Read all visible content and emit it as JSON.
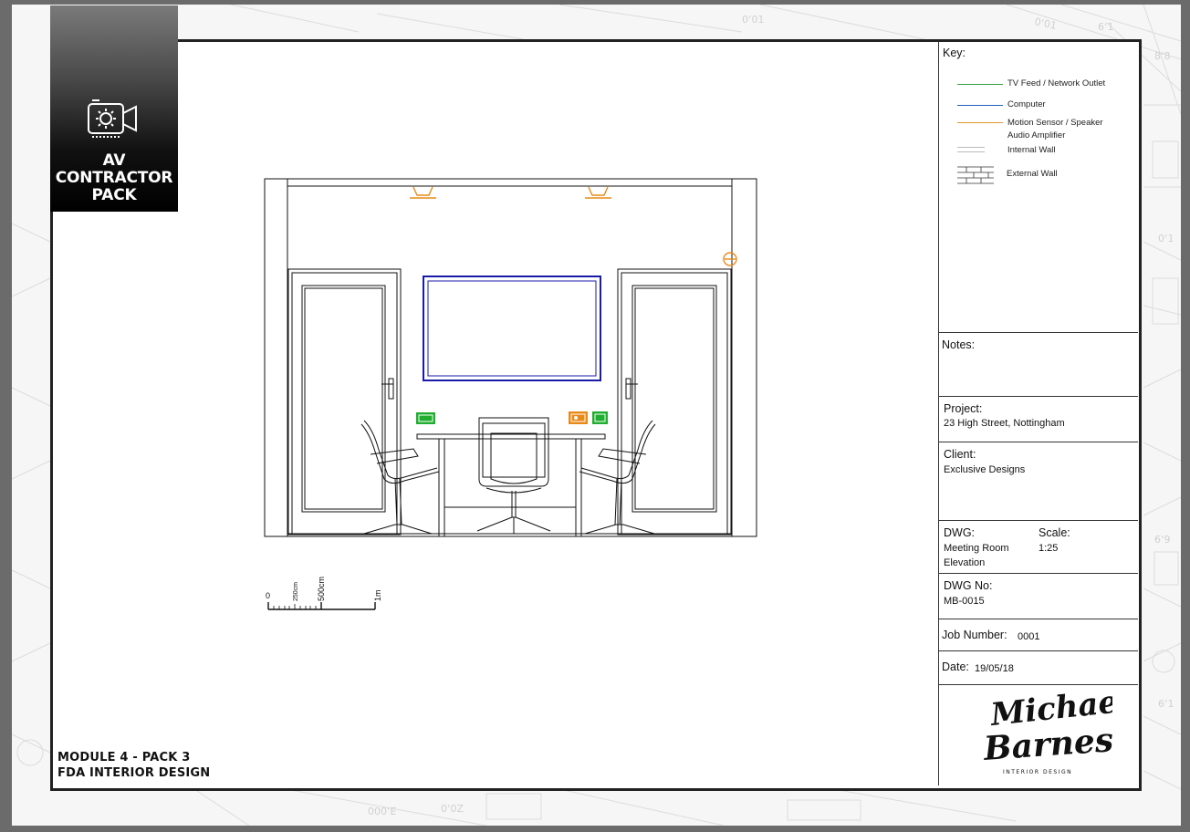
{
  "badge": {
    "line1": "AV",
    "line2": "CONTRACTOR",
    "line3": "PACK",
    "icon": "camera-gear-icon"
  },
  "module": {
    "line1": "MODULE 4 - PACK 3",
    "line2": "FDA INTERIOR DESIGN"
  },
  "title_block": {
    "key_label": "Key:",
    "key_items": [
      {
        "label": "TV Feed /  Network Outlet",
        "color": "#2e9e3e"
      },
      {
        "label": "Computer",
        "color": "#1f5fbf"
      },
      {
        "label": "Motion Sensor / Speaker",
        "color": "#e8942a"
      },
      {
        "label": "Audio Amplifier",
        "color": "#e8942a"
      },
      {
        "label": "Internal Wall",
        "color": "#999999"
      },
      {
        "label": "External Wall",
        "color": "#333333"
      }
    ],
    "notes_label": "Notes:",
    "project_label": "Project:",
    "project_value": "23 High Street, Nottingham",
    "client_label": "Client:",
    "client_value": "Exclusive Designs",
    "dwg_label": "DWG:",
    "dwg_value_line1": "Meeting Room",
    "dwg_value_line2": "Elevation",
    "scale_label": "Scale:",
    "scale_value": "1:25",
    "dwg_no_label": "DWG No:",
    "dwg_no_value": "MB-0015",
    "job_label": "Job Number:",
    "job_value": "0001",
    "date_label": "Date:",
    "date_value": "19/05/18",
    "logo_line1": "Michael",
    "logo_line2": "Barnes",
    "logo_tag": "INTERIOR DESIGN"
  },
  "scale_bar": {
    "t0": "0",
    "t1": "250cm",
    "t2": "500cm",
    "t3": "1m"
  },
  "colors": {
    "tv": "#1fae2f",
    "screen": "#1a1aa8",
    "sensor": "#e88a1a",
    "wall": "#111111"
  }
}
